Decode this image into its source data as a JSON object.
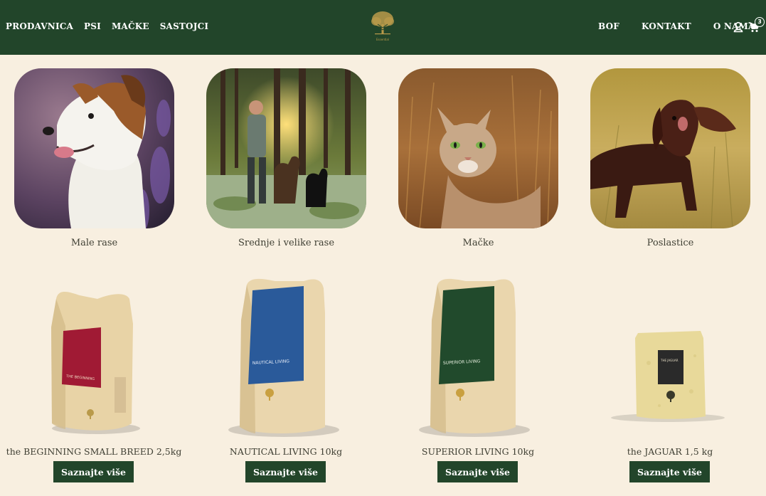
{
  "header": {
    "nav_left": [
      "PRODAVNICA",
      "PSI",
      "MAČKE",
      "SASTOJCI"
    ],
    "nav_right": [
      "BOF",
      "KONTAKT",
      "O NAMA"
    ],
    "logo_text": "Essential",
    "cart_count": "3",
    "brand_color": "#22452a"
  },
  "categories": [
    {
      "label": "Male rase",
      "icon": "small-dog-photo"
    },
    {
      "label": "Srednje i velike rase",
      "icon": "man-with-dogs-photo"
    },
    {
      "label": "Mačke",
      "icon": "cat-photo"
    },
    {
      "label": "Poslastice",
      "icon": "spaniel-photo"
    }
  ],
  "products": [
    {
      "name": "the BEGINNING SMALL BREED 2,5kg",
      "button": "Saznajte više",
      "label_color": "#a01a34",
      "bag_label": "THE BEGINNING"
    },
    {
      "name": "NAUTICAL LIVING 10kg",
      "button": "Saznajte više",
      "label_color": "#2a5a9a",
      "bag_label": "NAUTICAL LIVING"
    },
    {
      "name": "SUPERIOR LIVING 10kg",
      "button": "Saznajte više",
      "label_color": "#214a2c",
      "bag_label": "SUPERIOR LIVING"
    },
    {
      "name": "the JAGUAR 1,5 kg",
      "button": "Saznajte više",
      "label_color": "#2a2a2a",
      "bag_label": "THE JAGUAR"
    }
  ]
}
